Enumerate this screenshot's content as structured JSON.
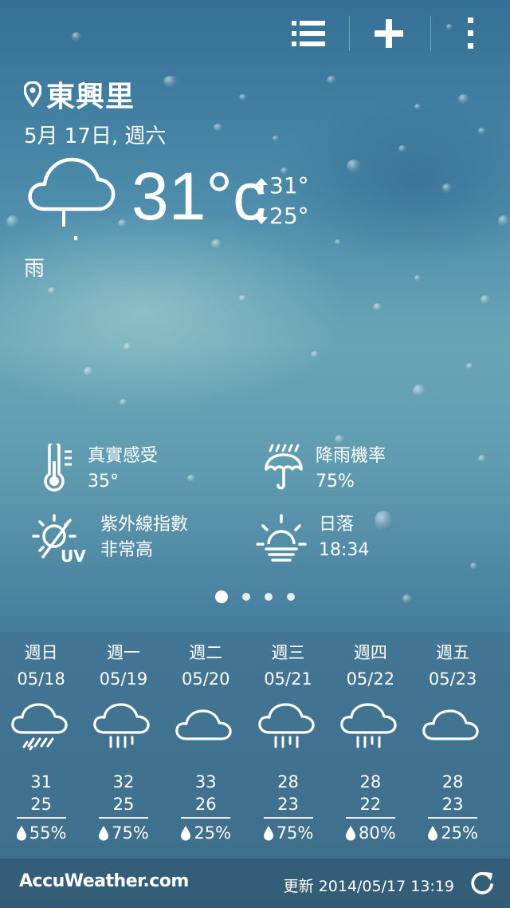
{
  "location": {
    "name": "東興里",
    "date": "5月 17日, 週六"
  },
  "current": {
    "temp": "31°c",
    "high": "31°",
    "low": "25°",
    "condition": "雨"
  },
  "details": [
    {
      "label": "真實感受",
      "value": "35°",
      "icon": "thermometer-icon"
    },
    {
      "label": "降雨機率",
      "value": "75%",
      "icon": "umbrella-icon"
    },
    {
      "label": "紫外線指數",
      "value": "非常高",
      "icon": "uv-sun-icon"
    },
    {
      "label": "日落",
      "value": "18:34",
      "icon": "sunset-icon"
    }
  ],
  "pager": {
    "count": 4,
    "active": 0
  },
  "forecast": [
    {
      "day": "週日",
      "date": "05/18",
      "high": "31",
      "low": "25",
      "rain": "55%",
      "icon": "thunder-rain-cloud-icon"
    },
    {
      "day": "週一",
      "date": "05/19",
      "high": "32",
      "low": "25",
      "rain": "75%",
      "icon": "rain-cloud-icon"
    },
    {
      "day": "週二",
      "date": "05/20",
      "high": "33",
      "low": "26",
      "rain": "25%",
      "icon": "cloud-icon"
    },
    {
      "day": "週三",
      "date": "05/21",
      "high": "28",
      "low": "23",
      "rain": "75%",
      "icon": "rain-cloud-icon"
    },
    {
      "day": "週四",
      "date": "05/22",
      "high": "28",
      "low": "22",
      "rain": "80%",
      "icon": "rain-cloud-icon"
    },
    {
      "day": "週五",
      "date": "05/23",
      "high": "28",
      "low": "23",
      "rain": "25%",
      "icon": "cloud-icon"
    }
  ],
  "footer": {
    "brand": "AccuWeather.com",
    "updated": "更新 2014/05/17 13:19"
  }
}
